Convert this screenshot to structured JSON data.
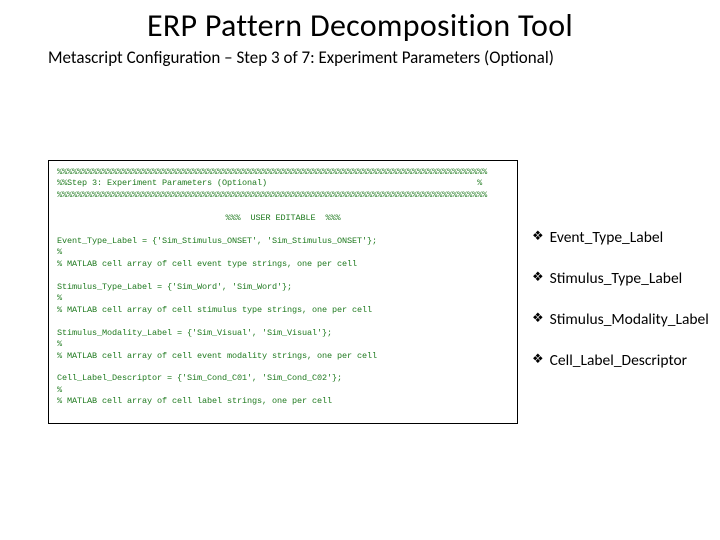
{
  "title": "ERP Pattern Decomposition Tool",
  "subtitle": "Metascript Configuration – Step 3 of 7: Experiment Parameters (Optional)",
  "code": {
    "banner_top": "%%%%%%%%%%%%%%%%%%%%%%%%%%%%%%%%%%%%%%%%%%%%%%%%%%%%%%%%%%%%%%%%%%%%%%%%%%%%%%%%%%%%%%",
    "banner_mid": "%%Step 3: Experiment Parameters (Optional)                                          %",
    "banner_bot": "%%%%%%%%%%%%%%%%%%%%%%%%%%%%%%%%%%%%%%%%%%%%%%%%%%%%%%%%%%%%%%%%%%%%%%%%%%%%%%%%%%%%%%",
    "editable": "%%%  USER EDITABLE  %%%",
    "l1": "Event_Type_Label = {'Sim_Stimulus_ONSET', 'Sim_Stimulus_ONSET'};",
    "l2": "%",
    "l3": "% MATLAB cell array of cell event type strings, one per cell",
    "l4": "Stimulus_Type_Label = {'Sim_Word', 'Sim_Word'};",
    "l5": "%",
    "l6": "% MATLAB cell array of cell stimulus type strings, one per cell",
    "l7": "Stimulus_Modality_Label = {'Sim_Visual', 'Sim_Visual'};",
    "l8": "%",
    "l9": "% MATLAB cell array of cell event modality strings, one per cell",
    "l10": "Cell_Label_Descriptor = {'Sim_Cond_C01', 'Sim_Cond_C02'};",
    "l11": "%",
    "l12": "% MATLAB cell array of cell label strings, one per cell"
  },
  "bullets": [
    "Event_Type_Label",
    "Stimulus_Type_Label",
    "Stimulus_Modality_Label",
    "Cell_Label_Descriptor"
  ]
}
